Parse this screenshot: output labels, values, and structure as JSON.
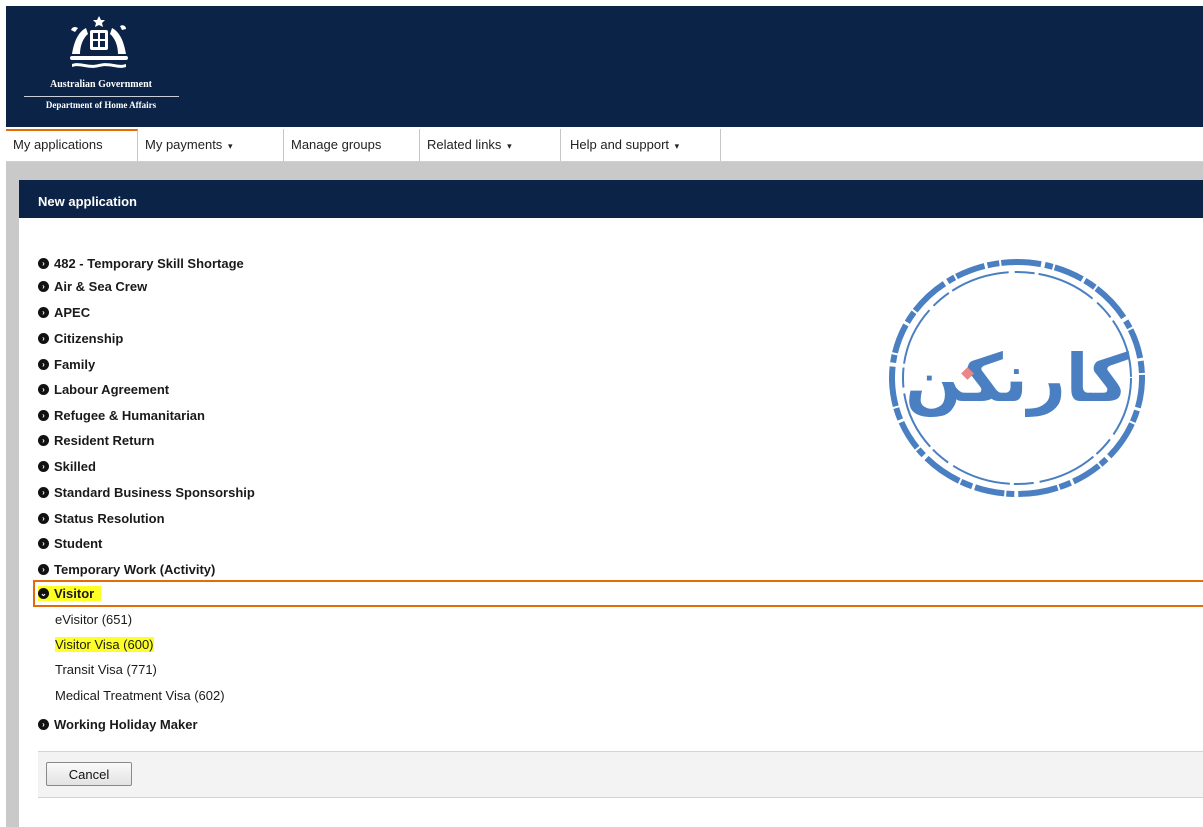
{
  "header": {
    "government": "Australian Government",
    "department": "Department of Home Affairs"
  },
  "nav": {
    "tabs": [
      {
        "label": "My applications",
        "dropdown": false
      },
      {
        "label": "My payments",
        "dropdown": true
      },
      {
        "label": "Manage groups",
        "dropdown": false
      },
      {
        "label": "Related links",
        "dropdown": true
      },
      {
        "label": "Help and support",
        "dropdown": true
      }
    ],
    "active": "My applications",
    "dropdown_caret": "▾"
  },
  "panel": {
    "title": "New application",
    "categories": [
      {
        "label": "482 - Temporary Skill Shortage"
      },
      {
        "label": "Air & Sea Crew"
      },
      {
        "label": "APEC"
      },
      {
        "label": "Citizenship"
      },
      {
        "label": "Family"
      },
      {
        "label": "Labour Agreement"
      },
      {
        "label": "Refugee & Humanitarian"
      },
      {
        "label": "Resident Return"
      },
      {
        "label": "Skilled"
      },
      {
        "label": "Standard Business Sponsorship"
      },
      {
        "label": "Status Resolution"
      },
      {
        "label": "Student"
      },
      {
        "label": "Temporary Work (Activity)"
      },
      {
        "label": "Visitor",
        "expanded": true,
        "highlighted": true
      },
      {
        "label": "Working Holiday Maker"
      }
    ],
    "visitor_subitems": [
      {
        "label": "eVisitor (651)"
      },
      {
        "label": "Visitor Visa (600)",
        "highlighted": true
      },
      {
        "label": "Transit Visa (771)"
      },
      {
        "label": "Medical Treatment Visa (602)"
      }
    ],
    "cancel_label": "Cancel"
  },
  "watermark": {
    "text": "کارنکن",
    "color": "#4a7fc2",
    "dot_color": "#e8868a"
  },
  "colors": {
    "navy": "#0b2346",
    "orange_accent": "#e36c0a",
    "highlight": "#ffff28"
  },
  "icons": {
    "collapsed": "circle-chevron-right-icon",
    "expanded": "circle-chevron-down-icon"
  }
}
